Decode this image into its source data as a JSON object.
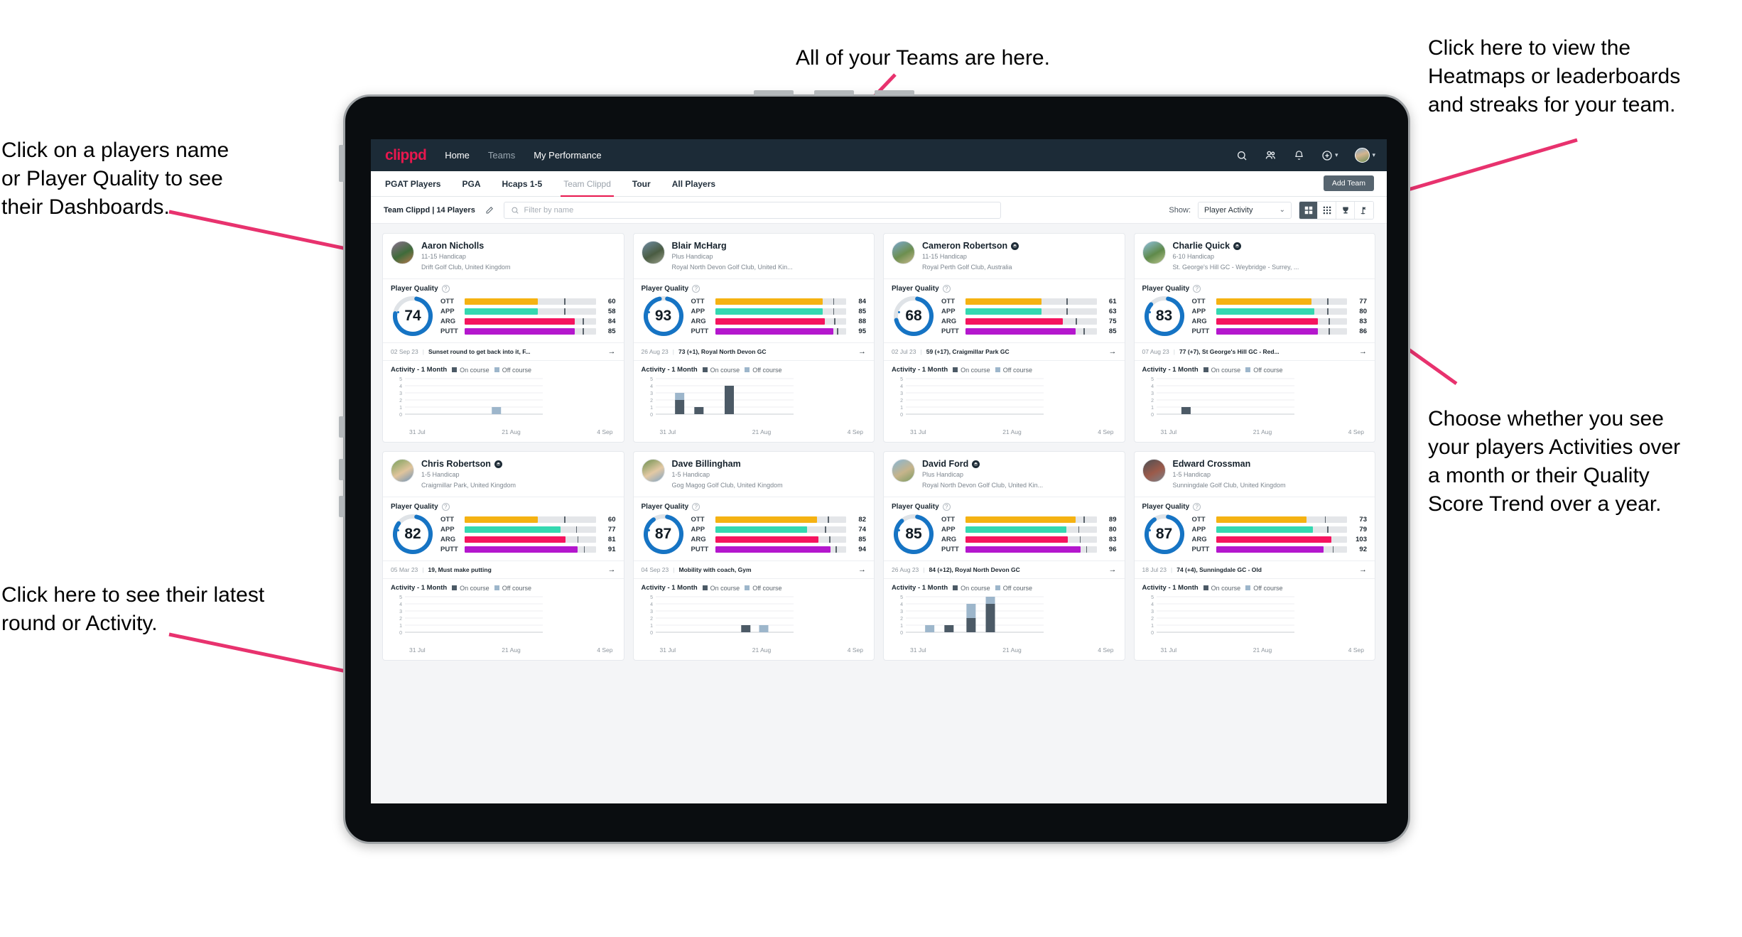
{
  "annotations": {
    "top_center": "All of your Teams are here.",
    "top_right": "Click here to view the\nHeatmaps or leaderboards\nand streaks for your team.",
    "left_top": "Click on a players name\nor Player Quality to see\ntheir Dashboards.",
    "right_mid": "Choose whether you see\nyour players Activities over\na month or their Quality\nScore Trend over a year.",
    "left_bottom": "Click here to see their latest\nround or Activity."
  },
  "navbar": {
    "logo": "clippd",
    "links": [
      {
        "label": "Home",
        "active": true
      },
      {
        "label": "Teams",
        "active": false
      },
      {
        "label": "My Performance",
        "active": true
      }
    ],
    "icons": [
      "search-icon",
      "people-icon",
      "bell-icon",
      "plus-circle-icon",
      "avatar"
    ]
  },
  "tabbar": {
    "tabs": [
      {
        "label": "PGAT Players",
        "active": false,
        "muted": false
      },
      {
        "label": "PGA",
        "active": false,
        "muted": false
      },
      {
        "label": "Hcaps 1-5",
        "active": false,
        "muted": false
      },
      {
        "label": "Team Clippd",
        "active": true,
        "muted": true
      },
      {
        "label": "Tour",
        "active": false,
        "muted": false
      },
      {
        "label": "All Players",
        "active": false,
        "muted": false
      }
    ],
    "add_team_label": "Add Team"
  },
  "toolbar": {
    "team_label": "Team Clippd | 14 Players",
    "edit_icon": "pencil-icon",
    "search_placeholder": "Filter by name",
    "search_value": "",
    "show_label": "Show:",
    "show_value": "Player Activity",
    "show_options": [
      "Player Activity",
      "Quality Score Trend"
    ],
    "view_buttons": [
      {
        "name": "grid-view-icon",
        "active": true
      },
      {
        "name": "dense-grid-view-icon",
        "active": false
      },
      {
        "name": "trophy-view-icon",
        "active": false
      },
      {
        "name": "flag-view-icon",
        "active": false
      }
    ]
  },
  "cards": [
    {
      "name": "Aaron Nicholls",
      "verified": false,
      "handicap": "11-15 Handicap",
      "club": "Drift Golf Club, United Kingdom",
      "avatar_colors": [
        "#8c6f8f",
        "#3f6b3a",
        "#b8784f"
      ],
      "pq_title": "Player Quality",
      "score": 74,
      "metrics": [
        {
          "label": "OTT",
          "value": 60,
          "color": "#f5b212",
          "fill": 56,
          "tick": 76
        },
        {
          "label": "APP",
          "value": 58,
          "color": "#34d8b0",
          "fill": 56,
          "tick": 76
        },
        {
          "label": "ARG",
          "value": 84,
          "color": "#f5145f",
          "fill": 84,
          "tick": 90
        },
        {
          "label": "PUTT",
          "value": 85,
          "color": "#b417cd",
          "fill": 84,
          "tick": 90
        }
      ],
      "round_date": "02 Sep 23",
      "round_text": "Sunset round to get back into it, F...",
      "activity": {
        "title": "Activity - 1 Month",
        "legend": [
          "On course",
          "Off course"
        ],
        "ymax": 5,
        "yticks": [
          5,
          4,
          3,
          2,
          1,
          0
        ],
        "xticks": [
          "31 Jul",
          "21 Aug",
          "4 Sep"
        ],
        "bars": [
          {
            "pos": 0.63,
            "on": 0,
            "off": 1
          }
        ]
      }
    },
    {
      "name": "Blair McHarg",
      "verified": false,
      "handicap": "Plus Handicap",
      "club": "Royal North Devon Golf Club, United Kin...",
      "avatar_colors": [
        "#6f8ca4",
        "#4a5c42",
        "#9aa08c"
      ],
      "pq_title": "Player Quality",
      "score": 93,
      "metrics": [
        {
          "label": "OTT",
          "value": 84,
          "color": "#f5b212",
          "fill": 82,
          "tick": 90
        },
        {
          "label": "APP",
          "value": 85,
          "color": "#34d8b0",
          "fill": 82,
          "tick": 90
        },
        {
          "label": "ARG",
          "value": 88,
          "color": "#f5145f",
          "fill": 84,
          "tick": 91
        },
        {
          "label": "PUTT",
          "value": 95,
          "color": "#b417cd",
          "fill": 90,
          "tick": 93
        }
      ],
      "round_date": "26 Aug 23",
      "round_text": "73 (+1), Royal North Devon GC",
      "activity": {
        "title": "Activity - 1 Month",
        "legend": [
          "On course",
          "Off course"
        ],
        "ymax": 5,
        "yticks": [
          5,
          4,
          3,
          2,
          1,
          0
        ],
        "xticks": [
          "31 Jul",
          "21 Aug",
          "4 Sep"
        ],
        "bars": [
          {
            "pos": 0.14,
            "on": 2,
            "off": 1
          },
          {
            "pos": 0.28,
            "on": 1,
            "off": 0
          },
          {
            "pos": 0.5,
            "on": 4,
            "off": 0
          }
        ]
      }
    },
    {
      "name": "Cameron Robertson",
      "verified": true,
      "handicap": "11-15 Handicap",
      "club": "Royal Perth Golf Club, Australia",
      "avatar_colors": [
        "#7aa8d1",
        "#6d8f4f",
        "#c9b98f"
      ],
      "pq_title": "Player Quality",
      "score": 68,
      "metrics": [
        {
          "label": "OTT",
          "value": 61,
          "color": "#f5b212",
          "fill": 58,
          "tick": 77
        },
        {
          "label": "APP",
          "value": 63,
          "color": "#34d8b0",
          "fill": 58,
          "tick": 77
        },
        {
          "label": "ARG",
          "value": 75,
          "color": "#f5145f",
          "fill": 74,
          "tick": 84
        },
        {
          "label": "PUTT",
          "value": 85,
          "color": "#b417cd",
          "fill": 84,
          "tick": 90
        }
      ],
      "round_date": "02 Jul 23",
      "round_text": "59 (+17), Craigmillar Park GC",
      "activity": {
        "title": "Activity - 1 Month",
        "legend": [
          "On course",
          "Off course"
        ],
        "ymax": 5,
        "yticks": [
          5,
          4,
          3,
          2,
          1,
          0
        ],
        "xticks": [
          "31 Jul",
          "21 Aug",
          "4 Sep"
        ],
        "bars": []
      }
    },
    {
      "name": "Charlie Quick",
      "verified": true,
      "handicap": "6-10 Handicap",
      "club": "St. George's Hill GC - Weybridge - Surrey, ...",
      "avatar_colors": [
        "#8fc0e0",
        "#5f8a4a",
        "#b9c48e"
      ],
      "pq_title": "Player Quality",
      "score": 83,
      "metrics": [
        {
          "label": "OTT",
          "value": 77,
          "color": "#f5b212",
          "fill": 73,
          "tick": 85
        },
        {
          "label": "APP",
          "value": 80,
          "color": "#34d8b0",
          "fill": 75,
          "tick": 85
        },
        {
          "label": "ARG",
          "value": 83,
          "color": "#f5145f",
          "fill": 78,
          "tick": 86
        },
        {
          "label": "PUTT",
          "value": 86,
          "color": "#b417cd",
          "fill": 78,
          "tick": 86
        }
      ],
      "round_date": "07 Aug 23",
      "round_text": "77 (+7), St George's Hill GC - Red...",
      "activity": {
        "title": "Activity - 1 Month",
        "legend": [
          "On course",
          "Off course"
        ],
        "ymax": 5,
        "yticks": [
          5,
          4,
          3,
          2,
          1,
          0
        ],
        "xticks": [
          "31 Jul",
          "21 Aug",
          "4 Sep"
        ],
        "bars": [
          {
            "pos": 0.18,
            "on": 1,
            "off": 0
          }
        ]
      }
    },
    {
      "name": "Chris Robertson",
      "verified": true,
      "handicap": "1-5 Handicap",
      "club": "Craigmillar Park, United Kingdom",
      "avatar_colors": [
        "#78a05c",
        "#e0c49c",
        "#6e93b8"
      ],
      "pq_title": "Player Quality",
      "score": 82,
      "metrics": [
        {
          "label": "OTT",
          "value": 60,
          "color": "#f5b212",
          "fill": 56,
          "tick": 76
        },
        {
          "label": "APP",
          "value": 77,
          "color": "#34d8b0",
          "fill": 73,
          "tick": 85
        },
        {
          "label": "ARG",
          "value": 81,
          "color": "#f5145f",
          "fill": 77,
          "tick": 86
        },
        {
          "label": "PUTT",
          "value": 91,
          "color": "#b417cd",
          "fill": 86,
          "tick": 91
        }
      ],
      "round_date": "05 Mar 23",
      "round_text": "19, Must make putting",
      "activity": {
        "title": "Activity - 1 Month",
        "legend": [
          "On course",
          "Off course"
        ],
        "ymax": 5,
        "yticks": [
          5,
          4,
          3,
          2,
          1,
          0
        ],
        "xticks": [
          "31 Jul",
          "21 Aug",
          "4 Sep"
        ],
        "bars": []
      }
    },
    {
      "name": "Dave Billingham",
      "verified": false,
      "handicap": "1-5 Handicap",
      "club": "Gog Magog Golf Club, United Kingdom",
      "avatar_colors": [
        "#6b8f4e",
        "#e3c9a4",
        "#7fa3c4"
      ],
      "pq_title": "Player Quality",
      "score": 87,
      "metrics": [
        {
          "label": "OTT",
          "value": 82,
          "color": "#f5b212",
          "fill": 78,
          "tick": 86
        },
        {
          "label": "APP",
          "value": 74,
          "color": "#34d8b0",
          "fill": 70,
          "tick": 84
        },
        {
          "label": "ARG",
          "value": 85,
          "color": "#f5145f",
          "fill": 79,
          "tick": 87
        },
        {
          "label": "PUTT",
          "value": 94,
          "color": "#b417cd",
          "fill": 88,
          "tick": 92
        }
      ],
      "round_date": "04 Sep 23",
      "round_text": "Mobility with coach, Gym",
      "activity": {
        "title": "Activity - 1 Month",
        "legend": [
          "On course",
          "Off course"
        ],
        "ymax": 5,
        "yticks": [
          5,
          4,
          3,
          2,
          1,
          0
        ],
        "xticks": [
          "31 Jul",
          "21 Aug",
          "4 Sep"
        ],
        "bars": [
          {
            "pos": 0.62,
            "on": 1,
            "off": 0
          },
          {
            "pos": 0.75,
            "on": 0,
            "off": 1
          }
        ]
      }
    },
    {
      "name": "David Ford",
      "verified": true,
      "handicap": "Plus Handicap",
      "club": "Royal North Devon Golf Club, United Kin...",
      "avatar_colors": [
        "#86b6d6",
        "#c6b48b",
        "#7b9b63"
      ],
      "pq_title": "Player Quality",
      "score": 85,
      "metrics": [
        {
          "label": "OTT",
          "value": 89,
          "color": "#f5b212",
          "fill": 84,
          "tick": 90
        },
        {
          "label": "APP",
          "value": 80,
          "color": "#34d8b0",
          "fill": 77,
          "tick": 86
        },
        {
          "label": "ARG",
          "value": 83,
          "color": "#f5145f",
          "fill": 78,
          "tick": 87
        },
        {
          "label": "PUTT",
          "value": 96,
          "color": "#b417cd",
          "fill": 88,
          "tick": 92
        }
      ],
      "round_date": "26 Aug 23",
      "round_text": "84 (+12), Royal North Devon GC",
      "activity": {
        "title": "Activity - 1 Month",
        "legend": [
          "On course",
          "Off course"
        ],
        "ymax": 5,
        "yticks": [
          5,
          4,
          3,
          2,
          1,
          0
        ],
        "xticks": [
          "31 Jul",
          "21 Aug",
          "4 Sep"
        ],
        "bars": [
          {
            "pos": 0.14,
            "on": 0,
            "off": 1
          },
          {
            "pos": 0.28,
            "on": 1,
            "off": 0
          },
          {
            "pos": 0.44,
            "on": 2,
            "off": 2
          },
          {
            "pos": 0.58,
            "on": 4,
            "off": 1
          }
        ]
      }
    },
    {
      "name": "Edward Crossman",
      "verified": false,
      "handicap": "1-5 Handicap",
      "club": "Sunningdale Golf Club, United Kingdom",
      "avatar_colors": [
        "#4a4f55",
        "#9c5a4a",
        "#7a828a"
      ],
      "pq_title": "Player Quality",
      "score": 87,
      "metrics": [
        {
          "label": "OTT",
          "value": 73,
          "color": "#f5b212",
          "fill": 69,
          "tick": 83
        },
        {
          "label": "APP",
          "value": 79,
          "color": "#34d8b0",
          "fill": 74,
          "tick": 85
        },
        {
          "label": "ARG",
          "value": 103,
          "color": "#f5145f",
          "fill": 88,
          "tick": 0
        },
        {
          "label": "PUTT",
          "value": 92,
          "color": "#b417cd",
          "fill": 82,
          "tick": 89
        }
      ],
      "round_date": "18 Jul 23",
      "round_text": "74 (+4), Sunningdale GC - Old",
      "activity": {
        "title": "Activity - 1 Month",
        "legend": [
          "On course",
          "Off course"
        ],
        "ymax": 5,
        "yticks": [
          5,
          4,
          3,
          2,
          1,
          0
        ],
        "xticks": [
          "31 Jul",
          "21 Aug",
          "4 Sep"
        ],
        "bars": []
      }
    }
  ],
  "colors": {
    "brand": "#e8174e",
    "nav_bg": "#1c2b37",
    "ring": "#1674c4",
    "on_course": "#4c5a66",
    "off_course": "#9db6cb"
  }
}
